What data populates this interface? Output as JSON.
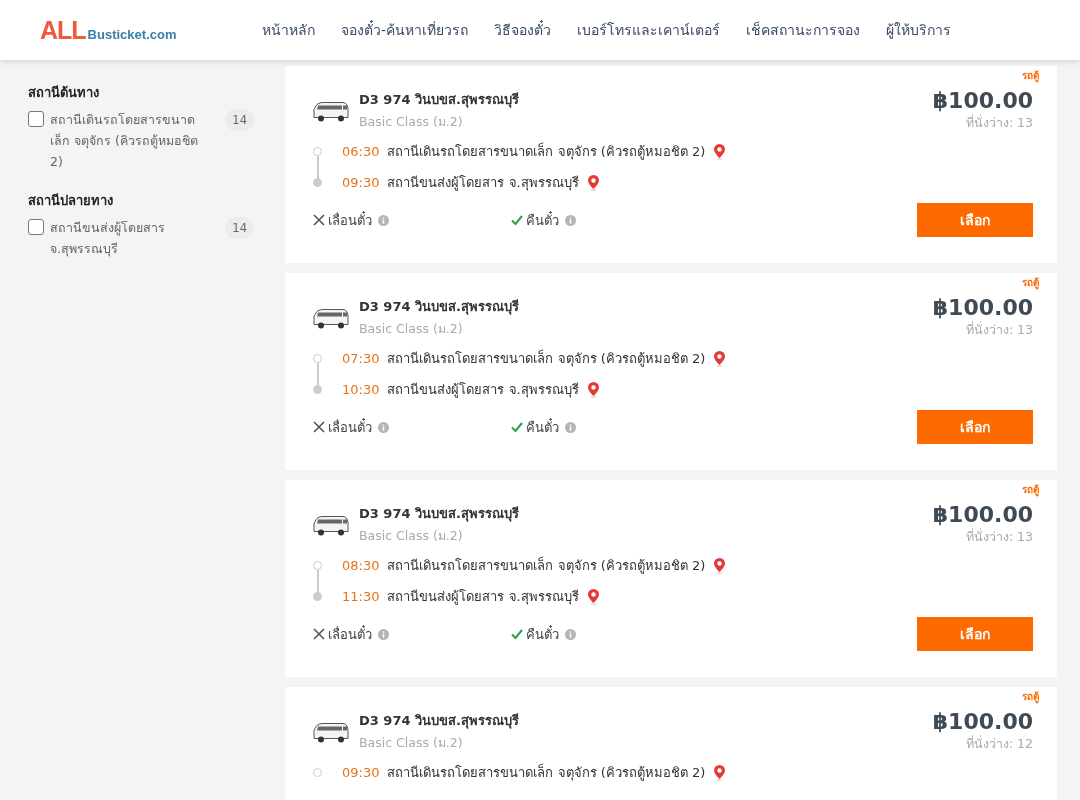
{
  "header": {
    "logo": {
      "main": "ALL",
      "sub": "Busticket.com"
    },
    "nav": [
      {
        "label": "หน้าหลัก"
      },
      {
        "label": "จองตั๋ว-ค้นหาเที่ยวรถ"
      },
      {
        "label": "วิธีจองตั๋ว"
      },
      {
        "label": "เบอร์โทรและเคาน์เตอร์"
      },
      {
        "label": "เช็คสถานะการจอง"
      },
      {
        "label": "ผู้ให้บริการ"
      }
    ]
  },
  "filters": [
    {
      "title": "สถานีต้นทาง",
      "options": [
        {
          "label": "สถานีเดินรถโดยสารขนาดเล็ก จตุจักร (คิวรถตู้หมอชิต 2)",
          "count": "14",
          "checked": false
        }
      ]
    },
    {
      "title": "สถานีปลายทาง",
      "options": [
        {
          "label": "สถานีขนส่งผู้โดยสาร จ.สุพรรณบุรี",
          "count": "14",
          "checked": false
        }
      ]
    }
  ],
  "trips": [
    {
      "vehicle_type": "รถตู้",
      "route": "D3 974 วินบขส.สุพรรณบุรี",
      "class": "Basic Class (ม.2)",
      "price": "฿100.00",
      "seats": "ที่นั่งว่าง: 13",
      "stops": [
        {
          "kind": "origin",
          "time": "06:30",
          "station": "สถานีเดินรถโดยสารขนาดเล็ก จตุจักร (คิวรถตู้หมอชิต 2)"
        },
        {
          "kind": "destination",
          "time": "09:30",
          "station": "สถานีขนส่งผู้โดยสาร จ.สุพรรณบุรี"
        }
      ],
      "policies": [
        {
          "label": "เลื่อนตั๋ว",
          "allowed": false
        },
        {
          "label": "คืนตั๋ว",
          "allowed": true
        }
      ],
      "button": "เลือก"
    },
    {
      "vehicle_type": "รถตู้",
      "route": "D3 974 วินบขส.สุพรรณบุรี",
      "class": "Basic Class (ม.2)",
      "price": "฿100.00",
      "seats": "ที่นั่งว่าง: 13",
      "stops": [
        {
          "kind": "origin",
          "time": "07:30",
          "station": "สถานีเดินรถโดยสารขนาดเล็ก จตุจักร (คิวรถตู้หมอชิต 2)"
        },
        {
          "kind": "destination",
          "time": "10:30",
          "station": "สถานีขนส่งผู้โดยสาร จ.สุพรรณบุรี"
        }
      ],
      "policies": [
        {
          "label": "เลื่อนตั๋ว",
          "allowed": false
        },
        {
          "label": "คืนตั๋ว",
          "allowed": true
        }
      ],
      "button": "เลือก"
    },
    {
      "vehicle_type": "รถตู้",
      "route": "D3 974 วินบขส.สุพรรณบุรี",
      "class": "Basic Class (ม.2)",
      "price": "฿100.00",
      "seats": "ที่นั่งว่าง: 13",
      "stops": [
        {
          "kind": "origin",
          "time": "08:30",
          "station": "สถานีเดินรถโดยสารขนาดเล็ก จตุจักร (คิวรถตู้หมอชิต 2)"
        },
        {
          "kind": "destination",
          "time": "11:30",
          "station": "สถานีขนส่งผู้โดยสาร จ.สุพรรณบุรี"
        }
      ],
      "policies": [
        {
          "label": "เลื่อนตั๋ว",
          "allowed": false
        },
        {
          "label": "คืนตั๋ว",
          "allowed": true
        }
      ],
      "button": "เลือก"
    },
    {
      "vehicle_type": "รถตู้",
      "route": "D3 974 วินบขส.สุพรรณบุรี",
      "class": "Basic Class (ม.2)",
      "price": "฿100.00",
      "seats": "ที่นั่งว่าง: 12",
      "stops": [
        {
          "kind": "origin",
          "time": "09:30",
          "station": "สถานีเดินรถโดยสารขนาดเล็ก จตุจักร (คิวรถตู้หมอชิต 2)"
        }
      ]
    }
  ]
}
